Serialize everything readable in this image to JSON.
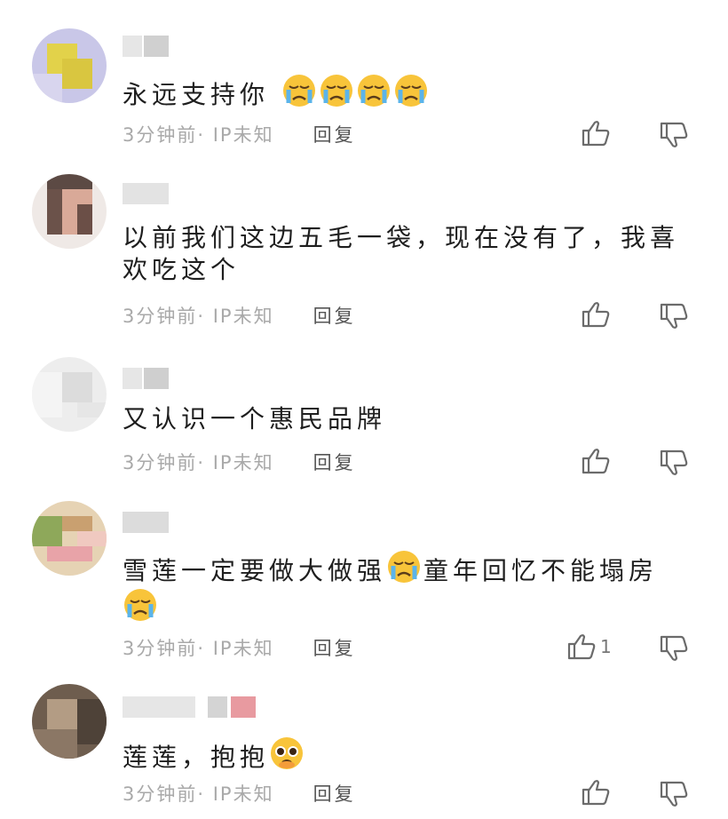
{
  "comments": [
    {
      "text": "永远支持你",
      "emoji_after": [
        "crying-face",
        "crying-face",
        "crying-face",
        "crying-face"
      ],
      "time": "3分钟前",
      "location": "· IP未知",
      "reply_label": "回复",
      "like_count": ""
    },
    {
      "text": "以前我们这边五毛一袋，现在没有了，我喜欢吃这个",
      "emoji_after": [],
      "time": "3分钟前",
      "location": "· IP未知",
      "reply_label": "回复",
      "like_count": ""
    },
    {
      "text": "又认识一个惠民品牌",
      "emoji_after": [],
      "time": "3分钟前",
      "location": "· IP未知",
      "reply_label": "回复",
      "like_count": ""
    },
    {
      "text_part1": "雪莲一定要做大做强",
      "text_part2": "童年回忆不能塌房",
      "emoji_after": [
        "crying-face",
        "crying-face"
      ],
      "time": "3分钟前",
      "location": "· IP未知",
      "reply_label": "回复",
      "like_count": "1"
    },
    {
      "text": "莲莲，抱抱",
      "emoji_after": [
        "pleading-face"
      ],
      "time": "3分钟前",
      "location": "· IP未知",
      "reply_label": "回复",
      "like_count": ""
    }
  ],
  "colors": {
    "meta_text": "#a9a9a9",
    "body_text": "#1e1e1e",
    "icon_stroke": "#6b6b6b"
  }
}
